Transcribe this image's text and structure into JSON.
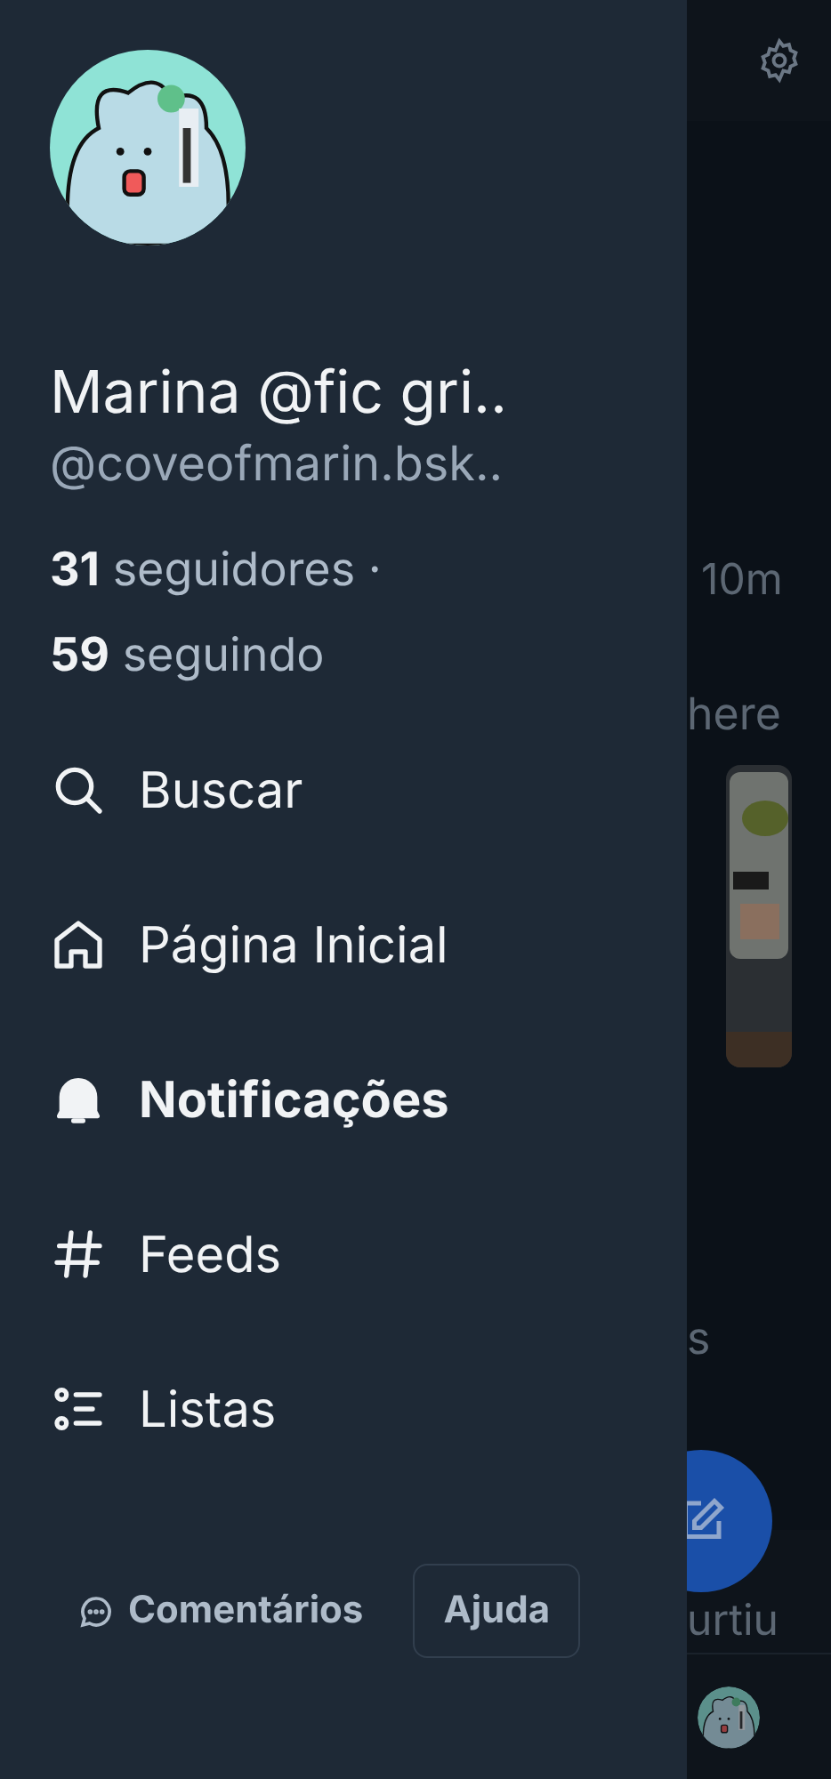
{
  "drawer": {
    "display_name": "Marina @fic gri..",
    "handle": "@coveofmarin.bsk..",
    "followers": {
      "count": "31",
      "label": "seguidores ·"
    },
    "following": {
      "count": "59",
      "label": "seguindo"
    },
    "nav": [
      {
        "kind": "search",
        "label": "Buscar",
        "selected": false
      },
      {
        "kind": "home",
        "label": "Página Inicial",
        "selected": false
      },
      {
        "kind": "bell",
        "label": "Notificações",
        "selected": true
      },
      {
        "kind": "hash",
        "label": "Feeds",
        "selected": false
      },
      {
        "kind": "list",
        "label": "Listas",
        "selected": false
      }
    ],
    "feedback_link": "Comentários",
    "help_button": "Ajuda"
  },
  "background_feed": {
    "texts": [
      "10m",
      "here",
      "s",
      "urtiu"
    ]
  }
}
